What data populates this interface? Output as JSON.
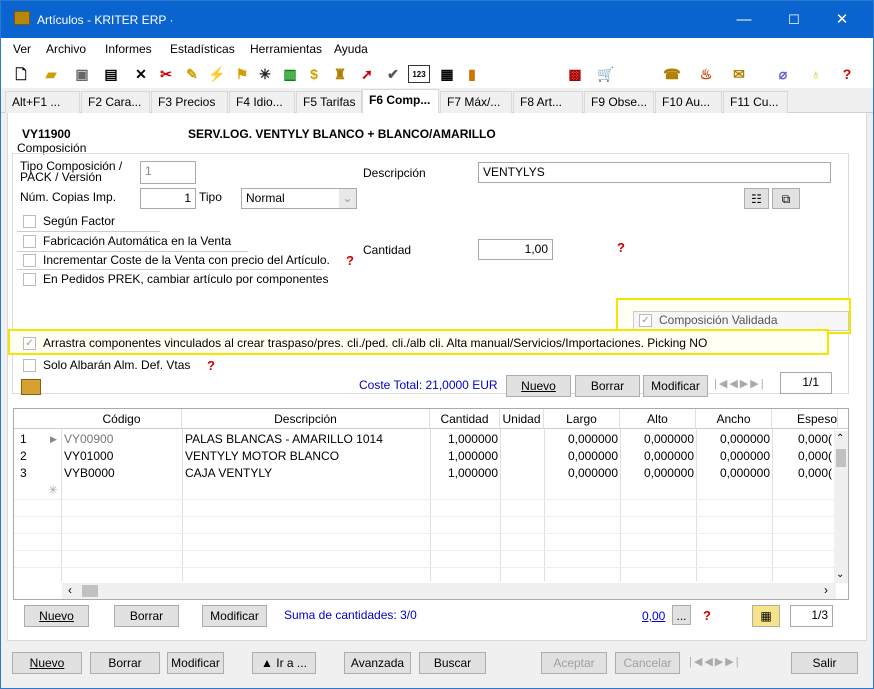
{
  "window": {
    "title": "Artículos - KRITER ERP ·",
    "minimize": "—",
    "maximize": "☐",
    "close": "✕"
  },
  "menu": [
    "Ver",
    "Archivo",
    "Informes",
    "Estadísticas",
    "Herramientas",
    "Ayuda"
  ],
  "toolbar_icons": [
    "new-doc-icon",
    "open-icon",
    "save-icon",
    "edit-icon",
    "delete-icon",
    "scissors-icon",
    "tool-icon",
    "wand-icon",
    "flag-icon",
    "star-icon",
    "box-icon",
    "dollar-icon",
    "pin-icon",
    "rocket-icon",
    "check-icon",
    "counter-icon",
    "printer-icon",
    "chart-icon",
    "calculator-icon",
    "cart-icon",
    "phone-icon",
    "bag-icon",
    "chat-icon",
    "clip-icon",
    "bulb-icon",
    "help-icon"
  ],
  "tabs": [
    "Alt+F1 ...",
    "F2 Cara...",
    "F3 Precios",
    "F4 Idio...",
    "F5 Tarifas",
    "F6 Comp...",
    "F7 Máx/...",
    "F8 Art...",
    "F9 Obse...",
    "F10 Au...",
    "F11 Cu..."
  ],
  "article": {
    "code": "VY11900",
    "name": "SERV.LOG. VENTYLY BLANCO + BLANCO/AMARILLO"
  },
  "section_label": "Composición",
  "form": {
    "tipo_label": "Tipo Composición / PACK / Versión",
    "tipo_value": "1",
    "copias_label": "Núm. Copias Imp.",
    "copias_value": "1",
    "tipo2_label": "Tipo",
    "tipo2_value": "Normal",
    "descripcion_label": "Descripción",
    "descripcion_value": "VENTYLYS",
    "cantidad_label": "Cantidad",
    "cantidad_value": "1,00"
  },
  "checkboxes": {
    "segun_factor": "Según Factor",
    "fabricacion": "Fabricación Automática en la Venta",
    "incrementar": "Incrementar Coste de la Venta con precio del Artículo.",
    "pedidos_prek": "En Pedidos PREK, cambiar artículo por componentes",
    "composicion_validada": "Composición Validada",
    "arrastra": "Arrastra componentes vinculados al crear traspaso/pres. cli./ped. cli./alb cli. Alta manual/Servicios/Importaciones. Picking NO",
    "solo_albaran": "Solo Albarán Alm. Def. Vtas"
  },
  "coste_total": "Coste Total: 21,0000 EUR",
  "upper_buttons": {
    "nuevo": "Nuevo",
    "borrar": "Borrar",
    "modificar": "Modificar",
    "pager": "1/1"
  },
  "grid": {
    "columns": [
      "Código",
      "Descripción",
      "Cantidad",
      "Unidad",
      "Largo",
      "Alto",
      "Ancho",
      "Espeso"
    ],
    "rows": [
      {
        "n": "1",
        "codigo": "VY00900",
        "descripcion": "PALAS BLANCAS - AMARILLO 1014",
        "cantidad": "1,000000",
        "unidad": "",
        "largo": "0,000000",
        "alto": "0,000000",
        "ancho": "0,000000",
        "espesor": "0,000("
      },
      {
        "n": "2",
        "codigo": "VY01000",
        "descripcion": "VENTYLY MOTOR BLANCO",
        "cantidad": "1,000000",
        "unidad": "",
        "largo": "0,000000",
        "alto": "0,000000",
        "ancho": "0,000000",
        "espesor": "0,000("
      },
      {
        "n": "3",
        "codigo": "VYB0000",
        "descripcion": "CAJA VENTYLY",
        "cantidad": "1,000000",
        "unidad": "",
        "largo": "0,000000",
        "alto": "0,000000",
        "ancho": "0,000000",
        "espesor": "0,000("
      }
    ]
  },
  "lower_buttons": {
    "nuevo": "Nuevo",
    "borrar": "Borrar",
    "modificar": "Modificar",
    "suma": "Suma de cantidades: 3/0",
    "total": "0,00",
    "dots": "...",
    "pager": "1/3"
  },
  "bottom_buttons": {
    "nuevo": "Nuevo",
    "borrar": "Borrar",
    "modificar": "Modificar",
    "ira": "▲ Ir a ...",
    "avanzada": "Avanzada",
    "buscar": "Buscar",
    "aceptar": "Aceptar",
    "cancelar": "Cancelar",
    "salir": "Salir"
  },
  "colors": {
    "titlebar": "#0a64d0",
    "highlight": "#f5e600",
    "link": "#0000cc"
  }
}
